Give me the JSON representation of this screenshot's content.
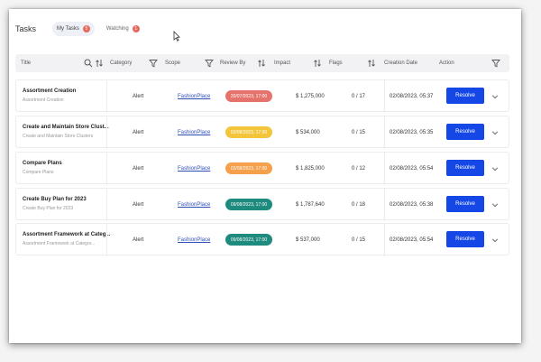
{
  "header": {
    "title": "Tasks",
    "tabs": [
      {
        "label": "My Tasks",
        "count": "5",
        "active": true
      },
      {
        "label": "Watching",
        "count": "1",
        "active": false
      }
    ]
  },
  "columns": {
    "title": "Title",
    "category": "Category",
    "scope": "Scope",
    "review_by": "Review By",
    "impact": "Impact",
    "flags": "Flags",
    "creation_date": "Creation Date",
    "action": "Action"
  },
  "rows": [
    {
      "title": "Assortment Creation",
      "subtitle": "Assortment Creation",
      "category": "Alert",
      "scope": "FashionPlace",
      "review_by": "20/07/2023, 17:00",
      "review_status_color": "#e5736b",
      "impact": "$ 1,275,000",
      "flags": "0 / 17",
      "creation_date": "02/08/2023, 05:37",
      "action": "Resolve"
    },
    {
      "title": "Create and Maintain Store Clust...",
      "subtitle": "Create and Maintain Store Clusters",
      "category": "Alert",
      "scope": "FashionPlace",
      "review_by": "02/08/2023, 17:00",
      "review_status_color": "#f2c53b",
      "impact": "$ 534,000",
      "flags": "0 / 15",
      "creation_date": "02/08/2023, 05:35",
      "action": "Resolve"
    },
    {
      "title": "Compare Plans",
      "subtitle": "Compare Plans",
      "category": "Alert",
      "scope": "FashionPlace",
      "review_by": "03/08/2023, 17:00",
      "review_status_color": "#f5a04a",
      "impact": "$ 1,825,000",
      "flags": "0 / 12",
      "creation_date": "02/08/2023, 05:54",
      "action": "Resolve"
    },
    {
      "title": "Create Buy Plan for 2023",
      "subtitle": "Create Buy Plan for 2023",
      "category": "Alert",
      "scope": "FashionPlace",
      "review_by": "09/08/2023, 17:00",
      "review_status_color": "#1f8a7e",
      "impact": "$ 1,787,640",
      "flags": "0 / 18",
      "creation_date": "02/08/2023, 05:38",
      "action": "Resolve"
    },
    {
      "title": "Assortment Framework at Categ...",
      "subtitle": "Assortment Framework at Categor...",
      "category": "Alert",
      "scope": "FashionPlace",
      "review_by": "09/08/2023, 17:00",
      "review_status_color": "#1f8a7e",
      "impact": "$ 537,000",
      "flags": "0 / 15",
      "creation_date": "02/08/2023, 05:54",
      "action": "Resolve"
    }
  ],
  "icons": {
    "search": "search-icon",
    "sort": "sort-icon",
    "filter": "filter-icon",
    "expand": "chevron-down-icon",
    "cursor": "mouse-cursor-icon"
  },
  "colors": {
    "primary_button": "#1447e6",
    "badge": "#e86a5f",
    "link": "#2f4fb8"
  }
}
